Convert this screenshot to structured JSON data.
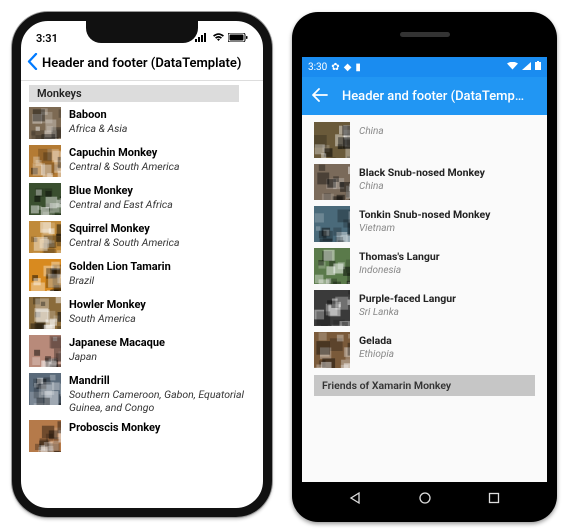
{
  "ios": {
    "status_time": "3:31",
    "back_label": "",
    "nav_title": "Header and footer (DataTemplate)",
    "section_header": "Monkeys",
    "items": [
      {
        "name": "Baboon",
        "loc": "Africa & Asia",
        "c": "#7d6a53"
      },
      {
        "name": "Capuchin Monkey",
        "loc": "Central & South America",
        "c": "#b47b34"
      },
      {
        "name": "Blue Monkey",
        "loc": "Central and East Africa",
        "c": "#3a4f2f"
      },
      {
        "name": "Squirrel Monkey",
        "loc": "Central & South America",
        "c": "#c08a3a"
      },
      {
        "name": "Golden Lion Tamarin",
        "loc": "Brazil",
        "c": "#d88a1f"
      },
      {
        "name": "Howler Monkey",
        "loc": "South America",
        "c": "#8a6b3a"
      },
      {
        "name": "Japanese Macaque",
        "loc": "Japan",
        "c": "#b88a7a"
      },
      {
        "name": "Mandrill",
        "loc": "Southern Cameroon, Gabon, Equatorial Guinea, and Congo",
        "c": "#5a6a7a"
      },
      {
        "name": "Proboscis Monkey",
        "loc": "",
        "c": "#b57a4a"
      }
    ]
  },
  "android": {
    "status_time": "3:30",
    "appbar_title": "Header and footer (DataTemp…",
    "items": [
      {
        "name": "",
        "loc": "China",
        "c": "#6a5a3a"
      },
      {
        "name": "Black Snub-nosed Monkey",
        "loc": "China",
        "c": "#7a6a5a"
      },
      {
        "name": "Tonkin Snub-nosed Monkey",
        "loc": "Vietnam",
        "c": "#4a6a7a"
      },
      {
        "name": "Thomas's Langur",
        "loc": "Indonesia",
        "c": "#5a7a4a"
      },
      {
        "name": "Purple-faced Langur",
        "loc": "Sri Lanka",
        "c": "#3a3a3a"
      },
      {
        "name": "Gelada",
        "loc": "Ethiopia",
        "c": "#7a5a3a"
      }
    ],
    "footer": "Friends of Xamarin Monkey"
  }
}
